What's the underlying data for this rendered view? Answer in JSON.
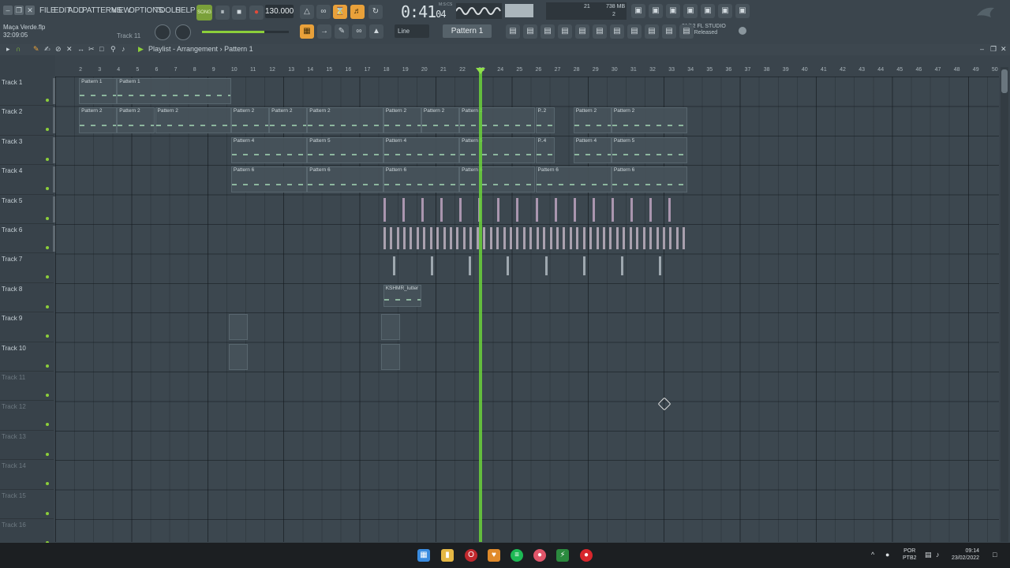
{
  "window": {
    "min": "–",
    "restore": "❐",
    "close": "✕"
  },
  "menu": [
    "FILE",
    "EDIT",
    "ADD",
    "PATTERNS",
    "VIEW",
    "OPTIONS",
    "TOOLS",
    "HELP"
  ],
  "project": {
    "filename": "Maça Verde.flp",
    "duration": "32:09:05",
    "track_hint": "Track 11"
  },
  "transport": {
    "song_label": "SONG",
    "play": "⏸",
    "stop": "■",
    "record": "●",
    "tempo": "130.000",
    "time_main": "0:41",
    "time_sub": "04",
    "time_format": "M:S:CS"
  },
  "monitor": {
    "cpu_value": "21",
    "memory": "738 MB",
    "voices": "2"
  },
  "toolbar2": {
    "snap": "Line",
    "pattern": "Pattern 1"
  },
  "news": {
    "line1": "21/12 FL STUDIO",
    "line2": "20.9 Released"
  },
  "playlist": {
    "breadcrumb": "Playlist - Arrangement",
    "separator": "›",
    "pattern": "Pattern 1"
  },
  "ruler_ticks": [
    "2",
    "3",
    "4",
    "5",
    "6",
    "7",
    "8",
    "9",
    "10",
    "11",
    "12",
    "13",
    "14",
    "15",
    "16",
    "17",
    "18",
    "19",
    "20",
    "21",
    "22",
    "23",
    "24",
    "25",
    "26",
    "27",
    "28",
    "29",
    "30",
    "31",
    "32",
    "33",
    "34",
    "35",
    "36",
    "37",
    "38",
    "39",
    "40",
    "41",
    "42",
    "43",
    "44",
    "45",
    "46",
    "47",
    "48",
    "49",
    "50"
  ],
  "tracks": [
    {
      "name": "Track 1",
      "active": true
    },
    {
      "name": "Track 2",
      "active": true
    },
    {
      "name": "Track 3",
      "active": true
    },
    {
      "name": "Track 4",
      "active": true
    },
    {
      "name": "Track 5",
      "active": true
    },
    {
      "name": "Track 6",
      "active": true
    },
    {
      "name": "Track 7",
      "active": true
    },
    {
      "name": "Track 8",
      "active": true
    },
    {
      "name": "Track 9",
      "active": true
    },
    {
      "name": "Track 10",
      "active": true
    },
    {
      "name": "Track 11",
      "active": false
    },
    {
      "name": "Track 12",
      "active": false
    },
    {
      "name": "Track 13",
      "active": false
    },
    {
      "name": "Track 14",
      "active": false
    },
    {
      "name": "Track 15",
      "active": false
    },
    {
      "name": "Track 16",
      "active": false
    }
  ],
  "clips": [
    {
      "track": 0,
      "bar": 2,
      "len": 2,
      "label": "Pattern 1"
    },
    {
      "track": 0,
      "bar": 4,
      "len": 6,
      "label": "Pattern 1"
    },
    {
      "track": 1,
      "bar": 2,
      "len": 2,
      "label": "Pattern 2"
    },
    {
      "track": 1,
      "bar": 4,
      "len": 2,
      "label": "Pattern 2"
    },
    {
      "track": 1,
      "bar": 6,
      "len": 4,
      "label": "Pattern 2"
    },
    {
      "track": 1,
      "bar": 10,
      "len": 2,
      "label": "Pattern 2"
    },
    {
      "track": 1,
      "bar": 12,
      "len": 2,
      "label": "Pattern 2"
    },
    {
      "track": 1,
      "bar": 14,
      "len": 4,
      "label": "Pattern 2"
    },
    {
      "track": 1,
      "bar": 18,
      "len": 2,
      "label": "Pattern 2"
    },
    {
      "track": 1,
      "bar": 20,
      "len": 2,
      "label": "Pattern 2"
    },
    {
      "track": 1,
      "bar": 22,
      "len": 4,
      "label": "Pattern 2"
    },
    {
      "track": 1,
      "bar": 26,
      "len": 1,
      "label": "P..2"
    },
    {
      "track": 1,
      "bar": 28,
      "len": 2,
      "label": "Pattern 2"
    },
    {
      "track": 1,
      "bar": 30,
      "len": 4,
      "label": "Pattern 2"
    },
    {
      "track": 2,
      "bar": 10,
      "len": 4,
      "label": "Pattern 4"
    },
    {
      "track": 2,
      "bar": 14,
      "len": 4,
      "label": "Pattern 5"
    },
    {
      "track": 2,
      "bar": 18,
      "len": 4,
      "label": "Pattern 4"
    },
    {
      "track": 2,
      "bar": 22,
      "len": 4,
      "label": "Pattern 5"
    },
    {
      "track": 2,
      "bar": 26,
      "len": 1,
      "label": "P..4"
    },
    {
      "track": 2,
      "bar": 28,
      "len": 2,
      "label": "Pattern 4"
    },
    {
      "track": 2,
      "bar": 30,
      "len": 4,
      "label": "Pattern 5"
    },
    {
      "track": 3,
      "bar": 10,
      "len": 4,
      "label": "Pattern 6"
    },
    {
      "track": 3,
      "bar": 14,
      "len": 4,
      "label": "Pattern 6"
    },
    {
      "track": 3,
      "bar": 18,
      "len": 4,
      "label": "Pattern 6"
    },
    {
      "track": 3,
      "bar": 22,
      "len": 4,
      "label": "Pattern 6"
    },
    {
      "track": 3,
      "bar": 26,
      "len": 4,
      "label": "Pattern 6"
    },
    {
      "track": 3,
      "bar": 30,
      "len": 4,
      "label": "Pattern 6"
    },
    {
      "track": 7,
      "bar": 18,
      "len": 2,
      "label": "KSHMR_lutter"
    }
  ],
  "taskbar": {
    "lang_top": "POR",
    "lang_bottom": "PTB2",
    "time": "09:14",
    "date": "23/02/2022",
    "tray_caret": "^"
  },
  "colors": {
    "accent_orange": "#e9a13a",
    "playhead": "#6ad23a",
    "song_green": "#7aa03a"
  }
}
